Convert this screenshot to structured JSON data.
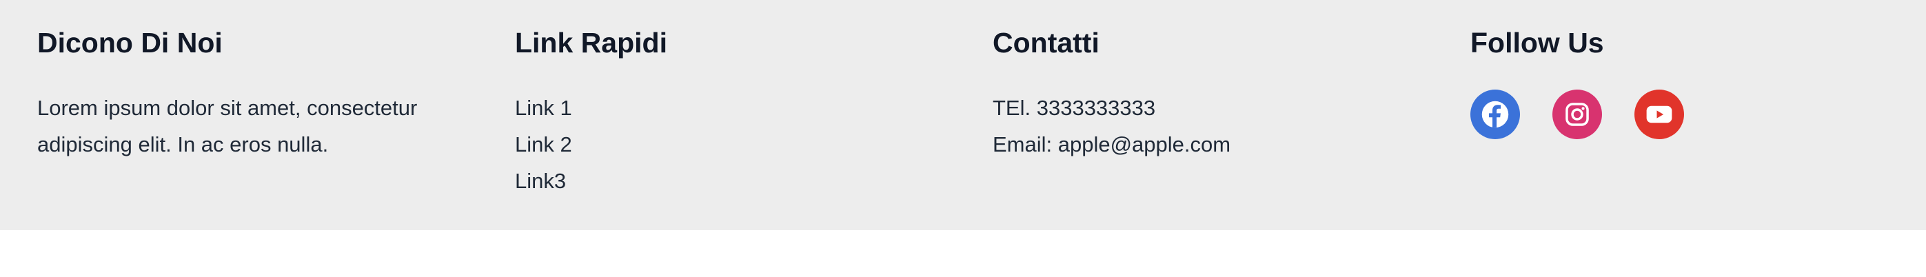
{
  "footer": {
    "about": {
      "title": "Dicono Di Noi",
      "text": "Lorem ipsum dolor sit amet, consectetur adipiscing elit. In ac eros nulla."
    },
    "quick_links": {
      "title": "Link Rapidi",
      "items": [
        "Link 1",
        "Link 2",
        "Link3"
      ]
    },
    "contacts": {
      "title": "Contatti",
      "phone": "TEl. 3333333333",
      "email": "Email: apple@apple.com"
    },
    "follow": {
      "title": "Follow Us",
      "icons": [
        {
          "name": "facebook-icon",
          "color": "#3b72d9"
        },
        {
          "name": "instagram-icon",
          "color": "#d8336f"
        },
        {
          "name": "youtube-icon",
          "color": "#e1342b"
        }
      ]
    }
  },
  "colors": {
    "footer_bg": "#ededed",
    "heading": "#111827",
    "text": "#1f2937"
  }
}
